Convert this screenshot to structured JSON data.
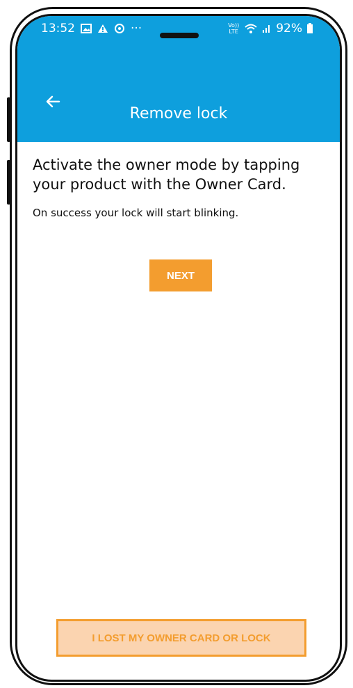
{
  "status_bar": {
    "time": "13:52",
    "left_icons": [
      "image-icon",
      "warning-icon",
      "sync-icon",
      "more-dots-icon"
    ],
    "more_text": "···",
    "volte_text": "Vo)) LTE",
    "battery": "92%"
  },
  "appbar": {
    "back_icon": "arrow-left-icon",
    "title": "Remove lock"
  },
  "content": {
    "heading": "Activate the owner mode by tapping your product with the Owner Card.",
    "subtext": "On success your lock will start blinking."
  },
  "buttons": {
    "next": "NEXT",
    "lost_card": "I LOST MY OWNER CARD OR LOCK"
  },
  "colors": {
    "primary": "#0e9fdd",
    "accent": "#f39d2f",
    "accent_light": "#fbd4b0"
  }
}
